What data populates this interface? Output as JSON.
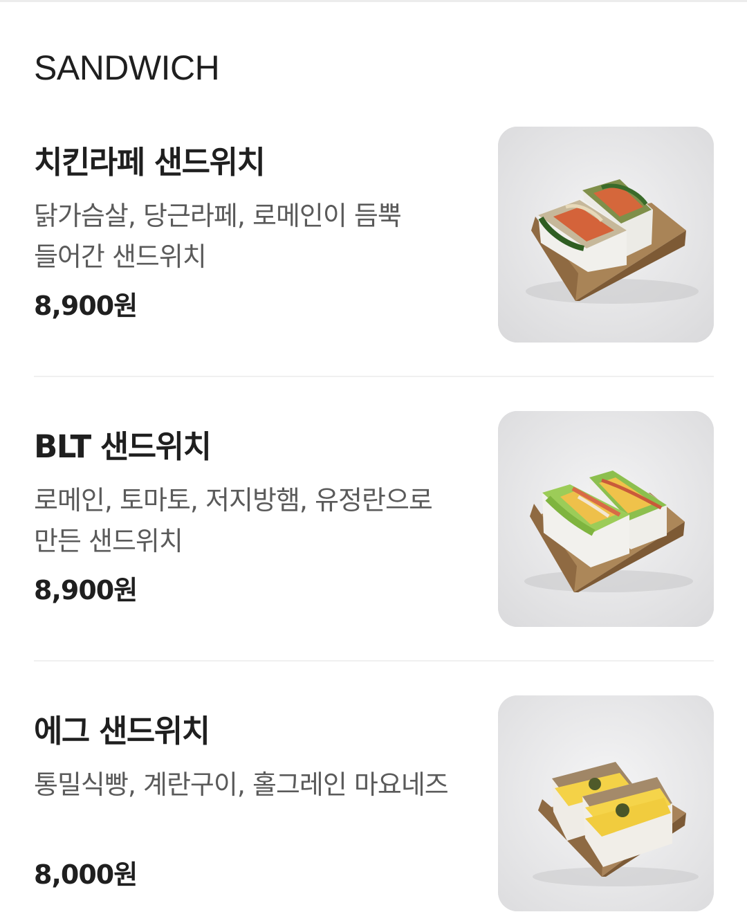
{
  "section": {
    "title": "SANDWICH"
  },
  "items": [
    {
      "name": "치킨라페 샌드위치",
      "description": "닭가슴살, 당근라페, 로메인이 듬뿍 들어간 샌드위치",
      "price": "8,900원",
      "photo": "chicken-rapee-sandwich-photo"
    },
    {
      "name": "BLT 샌드위치",
      "description": "로메인, 토마토, 저지방햄, 유정란으로 만든 샌드위치",
      "price": "8,900원",
      "photo": "blt-sandwich-photo"
    },
    {
      "name": "에그 샌드위치",
      "description": "통밀식빵, 계란구이, 홀그레인 마요네즈",
      "price": "8,000원",
      "photo": "egg-sandwich-photo"
    }
  ]
}
